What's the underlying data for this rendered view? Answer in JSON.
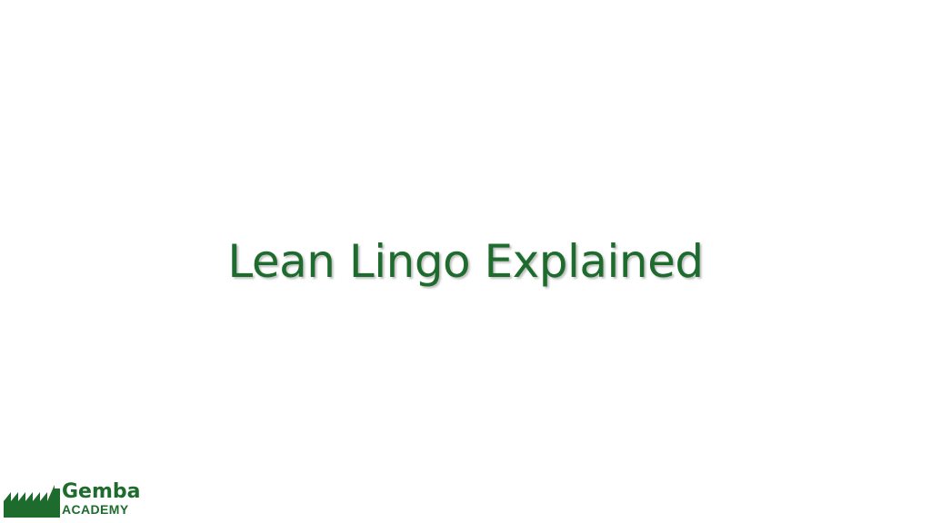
{
  "slide": {
    "title": "Lean Lingo Explained"
  },
  "logo": {
    "icon": "factory-icon",
    "word": "Gemba",
    "sub": "ACADEMY",
    "color": "#1e6b2e"
  }
}
